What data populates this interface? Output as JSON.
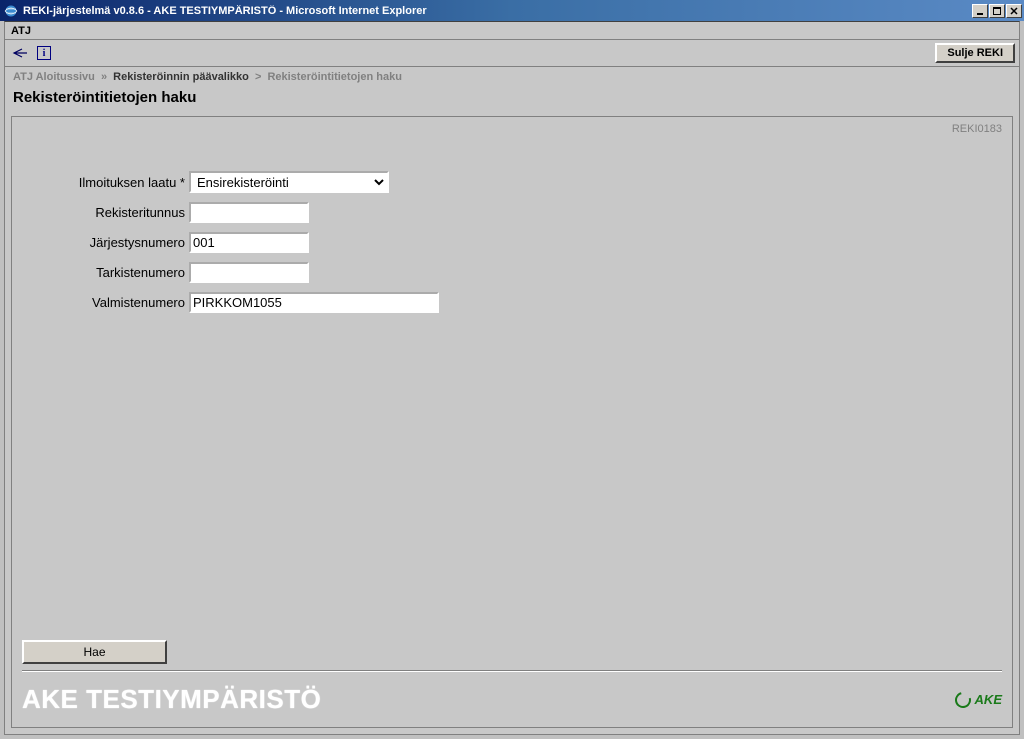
{
  "window": {
    "title": "REKI-järjestelmä v0.8.6 - AKE TESTIYMPÄRISTÖ - Microsoft Internet Explorer"
  },
  "menubar": {
    "atj": "ATJ"
  },
  "toolbar": {
    "close_label": "Sulje REKI"
  },
  "breadcrumb": {
    "seg1": "ATJ Aloitussivu",
    "seg2": "Rekisteröinnin päävalikko",
    "seg3": "Rekisteröintitietojen haku",
    "sep": "»",
    "sep2": ">"
  },
  "heading": "Rekisteröintitietojen haku",
  "page_code": "REKI0183",
  "form": {
    "labels": {
      "ilmoituksen_laatu": "Ilmoituksen laatu *",
      "rekisteritunnus": "Rekisteritunnus",
      "jarjestysnumero": "Järjestysnumero",
      "tarkistenumero": "Tarkistenumero",
      "valmistenumero": "Valmistenumero"
    },
    "values": {
      "ilmoituksen_laatu": "Ensirekisteröinti",
      "rekisteritunnus": "",
      "jarjestysnumero": "001",
      "tarkistenumero": "",
      "valmistenumero": "PIRKKOM1055"
    }
  },
  "buttons": {
    "hae": "Hae"
  },
  "footer": {
    "brand": "AKE TESTIYMPÄRISTÖ",
    "logo_text": "AKE"
  }
}
